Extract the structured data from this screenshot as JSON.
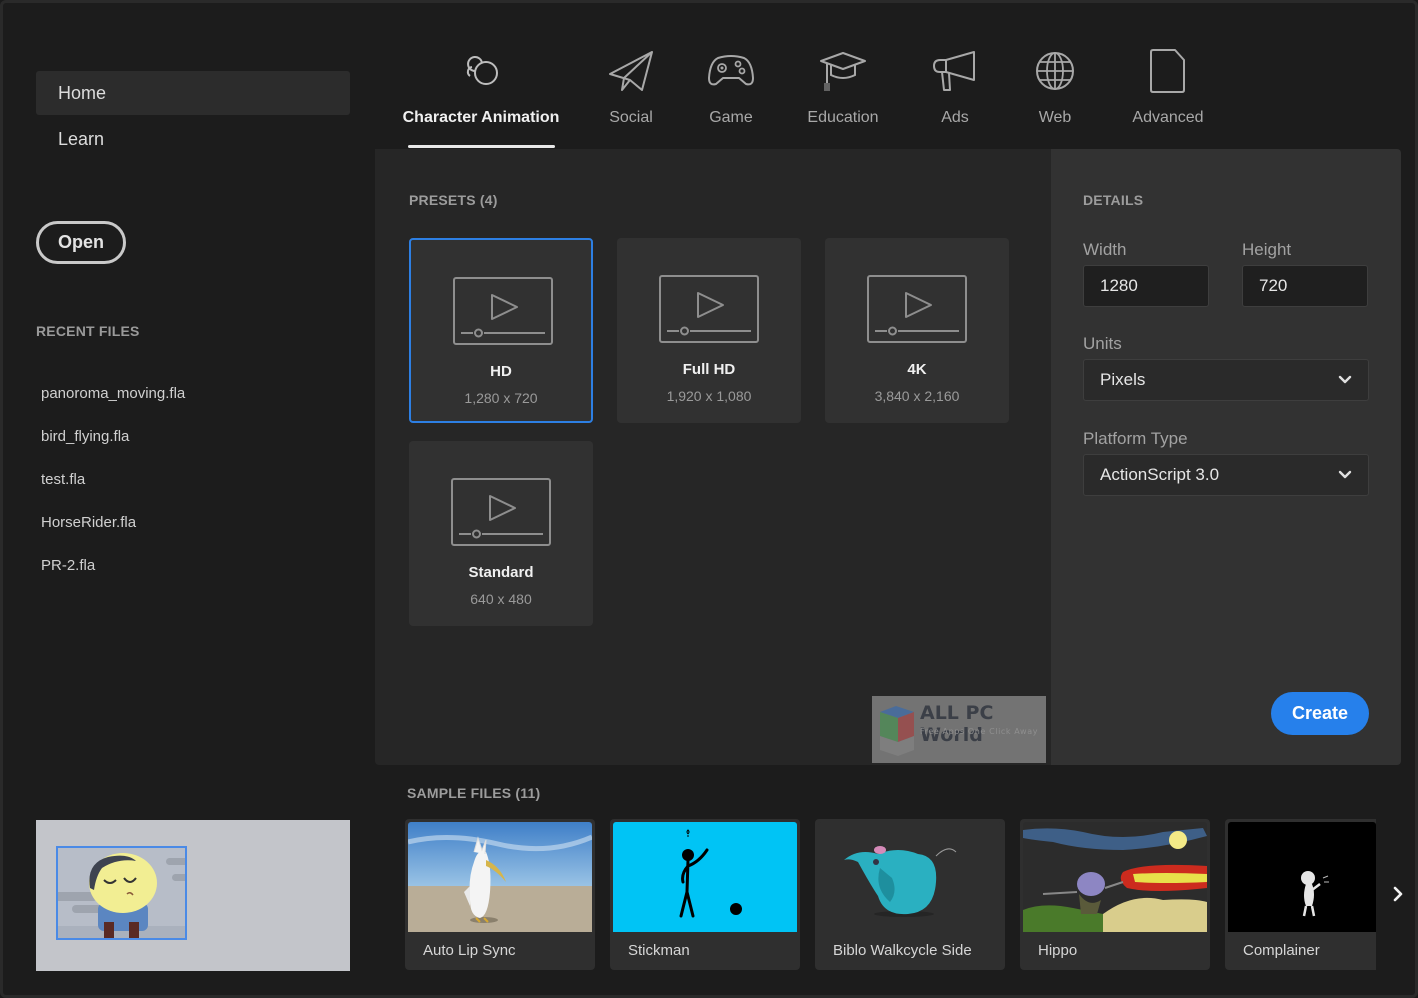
{
  "sidebar": {
    "nav": [
      {
        "label": "Home",
        "active": true
      },
      {
        "label": "Learn",
        "active": false
      }
    ],
    "open_label": "Open",
    "recent_title": "RECENT FILES",
    "recent_files": [
      "panoroma_moving.fla",
      "bird_flying.fla",
      "test.fla",
      "HorseRider.fla",
      "PR-2.fla"
    ]
  },
  "categories": [
    {
      "label": "Character Animation",
      "icon": "character-animation-icon",
      "active": true
    },
    {
      "label": "Social",
      "icon": "paper-plane-icon",
      "active": false
    },
    {
      "label": "Game",
      "icon": "gamepad-icon",
      "active": false
    },
    {
      "label": "Education",
      "icon": "graduation-cap-icon",
      "active": false
    },
    {
      "label": "Ads",
      "icon": "megaphone-icon",
      "active": false
    },
    {
      "label": "Web",
      "icon": "globe-icon",
      "active": false
    },
    {
      "label": "Advanced",
      "icon": "document-icon",
      "active": false
    }
  ],
  "presets": {
    "title": "PRESETS (4)",
    "items": [
      {
        "name": "HD",
        "dims": "1,280 x 720",
        "selected": true
      },
      {
        "name": "Full HD",
        "dims": "1,920 x 1,080",
        "selected": false
      },
      {
        "name": "4K",
        "dims": "3,840 x 2,160",
        "selected": false
      },
      {
        "name": "Standard",
        "dims": "640 x 480",
        "selected": false
      }
    ]
  },
  "details": {
    "title": "DETAILS",
    "width_label": "Width",
    "width_value": "1280",
    "height_label": "Height",
    "height_value": "720",
    "units_label": "Units",
    "units_value": "Pixels",
    "platform_label": "Platform Type",
    "platform_value": "ActionScript 3.0",
    "create_label": "Create"
  },
  "watermark": {
    "title": "ALL PC World",
    "subtitle": "Free Apps One Click Away"
  },
  "samples": {
    "title": "SAMPLE FILES (11)",
    "items": [
      "Auto Lip Sync",
      "Stickman",
      "Biblo Walkcycle Side",
      "Hippo",
      "Complainer"
    ]
  },
  "colors": {
    "accent": "#2680eb",
    "selected_border": "#2d7fe3",
    "background": "#1c1c1c",
    "panel": "#262626",
    "details_panel": "#323232"
  }
}
